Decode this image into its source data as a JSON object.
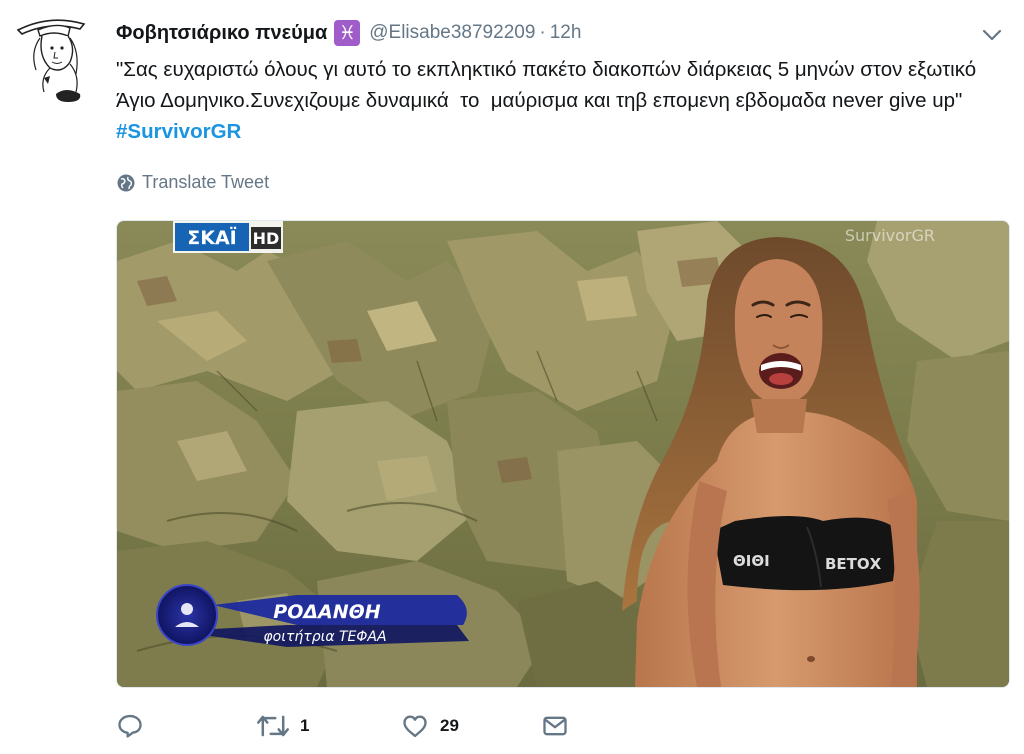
{
  "tweet": {
    "author": {
      "display_name": "Φοβητσιάρικο πνεύμα",
      "badge": "♓",
      "handle": "@Elisabe38792209",
      "separator": "·",
      "timestamp": "12h"
    },
    "text_body": "\"Σας ευχαριστώ όλους γι αυτό το εκπληκτικό πακέτο διακοπών διάρκειας 5 μηνών στον εξωτικό Άγιο Δομηνικο.Συνεχιζουμε δυναμικά  το  μαύρισμα και τηβ επομενη εβδομαδα never give up\" ",
    "hashtag": "#SurvivorGR",
    "translate_label": "Translate Tweet",
    "media": {
      "channel_logo": "ΣΚΑΪ",
      "channel_hd": "HD",
      "watermark": "SurvivorGR",
      "lower_third_name": "ΡΟΔΑΝΘΗ",
      "lower_third_subtitle": "φοιτήτρια ΤΕΦΑΑ",
      "bikini_print_left": "ΘΙΘΙ",
      "bikini_print_right": "ΒΕΤΟΧ"
    },
    "actions": {
      "reply_count": "",
      "retweet_count": "1",
      "like_count": "29",
      "dm_count": ""
    }
  },
  "colors": {
    "hashtag_blue": "#1b95e0",
    "muted_gray": "#657786",
    "pisces_badge": "#a05cc8"
  },
  "icons": [
    "profile-sketch",
    "pisces-icon",
    "chevron-down-icon",
    "globe-icon",
    "reply-icon",
    "retweet-icon",
    "heart-icon",
    "mail-icon"
  ]
}
